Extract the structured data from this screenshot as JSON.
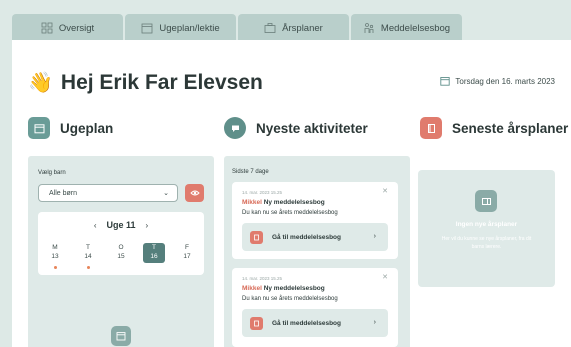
{
  "tabs": [
    {
      "label": "Oversigt",
      "icon": "grid-icon"
    },
    {
      "label": "Ugeplan/lektie",
      "icon": "calendar-icon"
    },
    {
      "label": "Årsplaner",
      "icon": "briefcase-icon"
    },
    {
      "label": "Meddelelsesbog",
      "icon": "family-icon"
    }
  ],
  "header": {
    "greeting_emoji": "👋",
    "greeting": "Hej Erik Far Elevsen",
    "date": "Torsdag den 16. marts 2023"
  },
  "ugeplan": {
    "title": "Ugeplan",
    "choose_child_label": "Vælg barn",
    "select_value": "Alle børn",
    "week_label": "Uge 11",
    "prev": "‹",
    "next": "›",
    "days": [
      {
        "letter": "M",
        "num": "13",
        "dot": true
      },
      {
        "letter": "T",
        "num": "14",
        "dot": true
      },
      {
        "letter": "O",
        "num": "15",
        "dot": false
      },
      {
        "letter": "T",
        "num": "16",
        "dot": false,
        "active": true
      },
      {
        "letter": "F",
        "num": "17",
        "dot": false
      }
    ]
  },
  "activities": {
    "title": "Nyeste aktiviteter",
    "period": "Sidste 7 dage",
    "items": [
      {
        "time": "14. mar. 2023 15.25",
        "name": "Mikkel",
        "subject": "Ny meddelelsesbog",
        "message": "Du kan nu se årets meddelelsesbog",
        "link": "Gå til meddelelsesbog"
      },
      {
        "time": "14. mar. 2023 15.25",
        "name": "Mikkel",
        "subject": "Ny meddelelsesbog",
        "message": "Du kan nu se årets meddelelsesbog",
        "link": "Gå til meddelelsesbog"
      }
    ]
  },
  "aarsplaner": {
    "title": "Seneste årsplaner",
    "empty_title": "Ingen nye årsplaner",
    "empty_desc": "Her vil du kunne se nye årsplaner, fra dit barns lærere."
  },
  "colors": {
    "background": "#dde9e6",
    "tab": "#b9cfcb",
    "accent_teal": "#6a9c97",
    "accent_coral": "#e07b6d",
    "panel": "#dfeae8"
  }
}
